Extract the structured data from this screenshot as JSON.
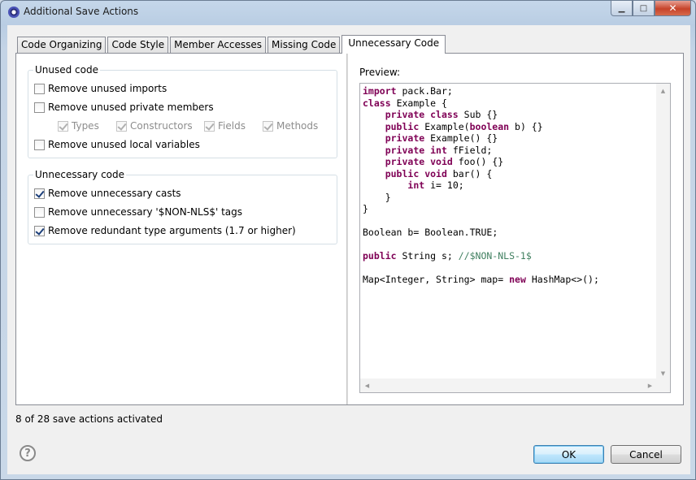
{
  "window": {
    "title": "Additional Save Actions",
    "minimize_glyph": "▁",
    "maximize_glyph": "□",
    "close_glyph": "✕"
  },
  "tabs": [
    {
      "label": "Code Organizing",
      "active": false
    },
    {
      "label": "Code Style",
      "active": false
    },
    {
      "label": "Member Accesses",
      "active": false
    },
    {
      "label": "Missing Code",
      "active": false
    },
    {
      "label": "Unnecessary Code",
      "active": true
    }
  ],
  "unused_group": {
    "title": "Unused code",
    "remove_unused_imports": {
      "label": "Remove unused imports",
      "checked": false
    },
    "remove_unused_private_members": {
      "label": "Remove unused private members",
      "checked": false
    },
    "sub_types": {
      "label": "Types",
      "checked": true,
      "enabled": false
    },
    "sub_constructors": {
      "label": "Constructors",
      "checked": true,
      "enabled": false
    },
    "sub_fields": {
      "label": "Fields",
      "checked": true,
      "enabled": false
    },
    "sub_methods": {
      "label": "Methods",
      "checked": true,
      "enabled": false
    },
    "remove_unused_locals": {
      "label": "Remove unused local variables",
      "checked": false
    }
  },
  "unnecessary_group": {
    "title": "Unnecessary code",
    "remove_casts": {
      "label": "Remove unnecessary casts",
      "checked": true
    },
    "remove_nls_tags": {
      "label": "Remove unnecessary '$NON-NLS$' tags",
      "checked": false
    },
    "remove_type_args": {
      "label": "Remove redundant type arguments (1.7 or higher)",
      "checked": true
    }
  },
  "preview": {
    "label": "Preview:",
    "code_lines": [
      "import pack.Bar;",
      "class Example {",
      "    private class Sub {}",
      "    public Example(boolean b) {}",
      "    private Example() {}",
      "    private int fField;",
      "    private void foo() {}",
      "    public void bar() {",
      "        int i= 10;",
      "    }",
      "}",
      "",
      "Boolean b= Boolean.TRUE;",
      "",
      "public String s; //$NON-NLS-1$",
      "",
      "Map<Integer, String> map= new HashMap<>();"
    ],
    "keywords": [
      "import",
      "class",
      "private",
      "public",
      "boolean",
      "int",
      "void",
      "new"
    ]
  },
  "status_text": "8 of 28 save actions activated",
  "help_glyph": "?",
  "buttons": {
    "ok": "OK",
    "cancel": "Cancel"
  }
}
